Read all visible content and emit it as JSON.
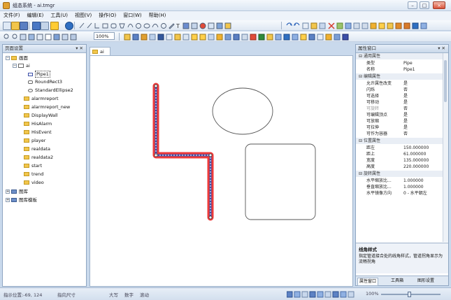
{
  "window": {
    "title": "组态系统 - ai.tmgr"
  },
  "menu": [
    "文件(F)",
    "编辑(E)",
    "工具(U)",
    "视图(V)",
    "操作(O)",
    "窗口(W)",
    "帮助(H)"
  ],
  "toolbar": {
    "zoom": "100%"
  },
  "left_panel": {
    "title": "页面设置",
    "tree": [
      {
        "label": "画面"
      },
      {
        "label": "ai"
      },
      {
        "label": "Pipe1"
      },
      {
        "label": "RoundRect3"
      },
      {
        "label": "StandardEllipse2"
      },
      {
        "label": "alarmreport"
      },
      {
        "label": "alarmreport_new"
      },
      {
        "label": "DisplayWall"
      },
      {
        "label": "HisAlarm"
      },
      {
        "label": "HisEvent"
      },
      {
        "label": "player"
      },
      {
        "label": "realdata"
      },
      {
        "label": "realdata2"
      },
      {
        "label": "start"
      },
      {
        "label": "trend"
      },
      {
        "label": "video"
      },
      {
        "label": "图库"
      },
      {
        "label": "图库模板"
      }
    ]
  },
  "document": {
    "tab_label": "ai"
  },
  "right_panel": {
    "title": "属性窗口",
    "rows": [
      {
        "cat": "通用属性"
      },
      {
        "k": "类型",
        "v": "Pipe"
      },
      {
        "k": "名称",
        "v": "Pipe1"
      },
      {
        "cat": "编辑属性"
      },
      {
        "k": "允许属性改变",
        "v": "是"
      },
      {
        "k": "闪烁",
        "v": "否"
      },
      {
        "k": "可选择",
        "v": "是"
      },
      {
        "k": "可移动",
        "v": "是"
      },
      {
        "k": "可旋转",
        "v": "否"
      },
      {
        "k": "可编辑顶点",
        "v": "是"
      },
      {
        "k": "可放缩",
        "v": "是"
      },
      {
        "k": "可拉伸",
        "v": "是"
      },
      {
        "k": "可作为容器",
        "v": "否"
      },
      {
        "cat": "位置属性"
      },
      {
        "k": "距左",
        "v": "150.000000"
      },
      {
        "k": "距上",
        "v": "61.000000"
      },
      {
        "k": "宽度",
        "v": "135.000000"
      },
      {
        "k": "高度",
        "v": "220.000000"
      },
      {
        "cat": "旋转属性"
      },
      {
        "k": "水平缩放比...",
        "v": "1.000000"
      },
      {
        "k": "垂直缩放比...",
        "v": "1.000000"
      },
      {
        "k": "水平镜像方向",
        "v": "0 - 水平朝左"
      }
    ],
    "desc_title": "线角样式",
    "desc_text": "指定管道接合处的线角样式，管道拐角显示为流畅拐角",
    "tabs": [
      "属性窗口",
      "工具箱",
      "图形设置"
    ]
  },
  "statusbar": {
    "pos": "指示位置:-69, 124",
    "size": "指向尺寸",
    "caps": "大写",
    "num": "数字",
    "scroll": "滚动",
    "zoom": "100%"
  },
  "colors": {
    "pipe_outline": "#ee3a3a",
    "pipe_core": "#3c4fa8",
    "panel_border": "#8fa6c2"
  }
}
